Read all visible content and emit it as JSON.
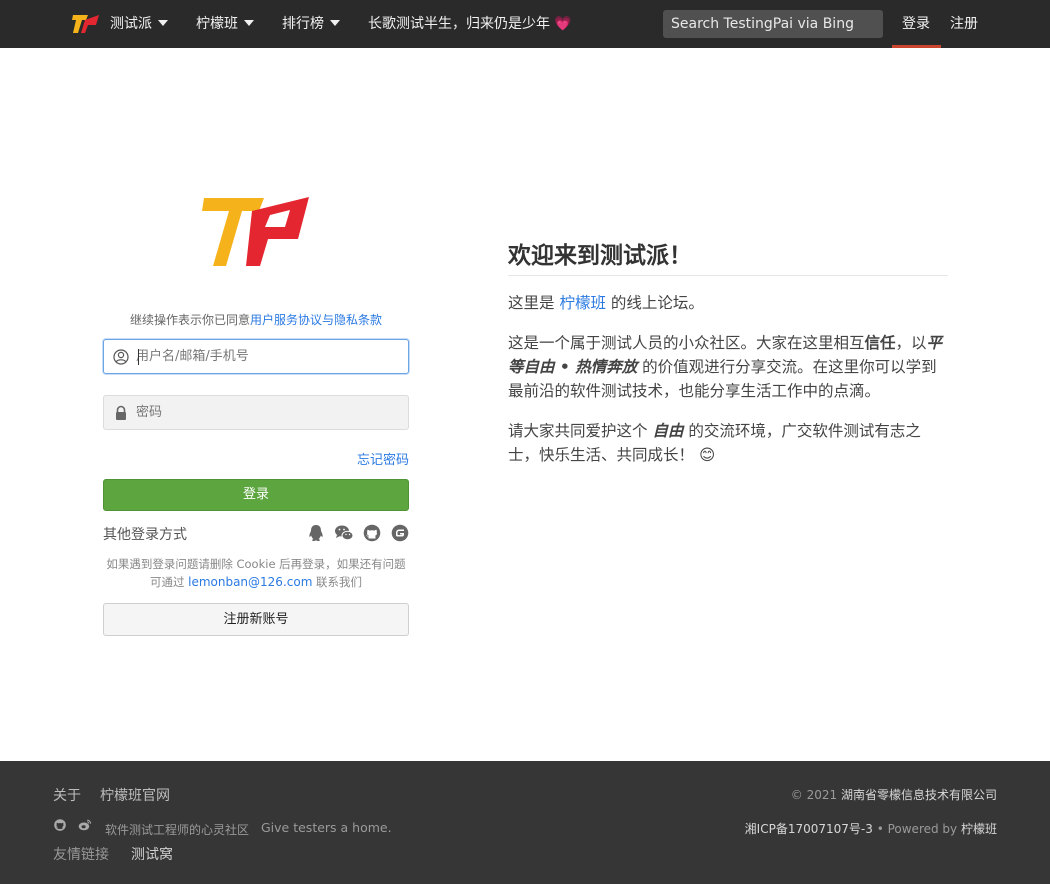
{
  "nav": {
    "brand_label": "测试派",
    "menu_lemonban": "柠檬班",
    "menu_rank": "排行榜",
    "slogan": "长歌测试半生，归来仍是少年",
    "slogan_heart": "💗",
    "search_placeholder": "Search TestingPai via Bing",
    "login": "登录",
    "register": "注册"
  },
  "login_form": {
    "agree_prefix": "继续操作表示你已同意",
    "agree_link": "用户服务协议与隐私条款",
    "username_placeholder": "用户名/邮箱/手机号",
    "password_placeholder": "密码",
    "forgot": "忘记密码",
    "submit": "登录",
    "other_methods": "其他登录方式",
    "help_text_1": "如果遇到登录问题请删除 Cookie 后再登录，如果还有问题可通过",
    "help_email": "lemonban@126.com",
    "help_text_2": "联系我们",
    "register_button": "注册新账号"
  },
  "welcome": {
    "title": "欢迎来到测试派！",
    "line1_prefix": "这里是",
    "line1_link": "柠檬班",
    "line1_suffix": "的线上论坛。",
    "p2_a": "这是一个属于测试人员的小众社区。大家在这里相互",
    "p2_bold": "信任",
    "p2_b": "，以",
    "p2_em": "平等自由 • 热情奔放",
    "p2_c": "的价值观进行分享交流。在这里你可以学到最前沿的软件测试技术，也能分享生活工作中的点滴。",
    "p3_a": "请大家共同爱护这个",
    "p3_em": "自由",
    "p3_b": "的交流环境，广交软件测试有志之士，快乐生活、共同成长！",
    "p3_emoji": "😊"
  },
  "footer": {
    "about": "关于",
    "official_site": "柠檬班官网",
    "community": "软件测试工程师的心灵社区",
    "motto": "Give testers a home.",
    "friend_links": "友情链接",
    "testwo": "测试窝",
    "copyright_prefix": "© 2021",
    "company": "湖南省零檬信息技术有限公司",
    "icp": "湘ICP备17007107号-3",
    "powered_prefix": "• Powered by",
    "powered_by": "柠檬班"
  },
  "colors": {
    "navbar": "#2a2a2a",
    "login_green": "#5ca53f",
    "link_blue": "#2a7ae2",
    "logo_yellow": "#f5b21b",
    "logo_red": "#e3262f",
    "footer": "#363636"
  }
}
